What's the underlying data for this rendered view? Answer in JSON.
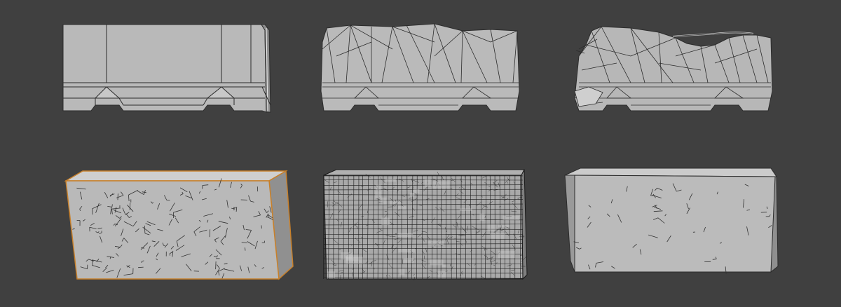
{
  "viewport": {
    "background": "#404040"
  },
  "colors": {
    "mesh_face": "#b8b8b8",
    "mesh_face_light": "#c4c4c4",
    "mesh_face_dark": "#9a9a9a",
    "mesh_side": "#8c8c8c",
    "wire": "#2c2c2c",
    "selection_outline": "#c8802a",
    "dense_wire": "#1a1a1a"
  },
  "objects": [
    {
      "id": "barrier-clean",
      "kind": "jersey-barrier",
      "row": 1,
      "col": 1,
      "selected": false,
      "style": "low-poly"
    },
    {
      "id": "barrier-rough",
      "kind": "jersey-barrier",
      "row": 1,
      "col": 2,
      "selected": false,
      "style": "deformed"
    },
    {
      "id": "barrier-broken",
      "kind": "jersey-barrier",
      "row": 1,
      "col": 3,
      "selected": false,
      "style": "damaged"
    },
    {
      "id": "block-selected",
      "kind": "concrete-block",
      "row": 2,
      "col": 1,
      "selected": true,
      "style": "scatter-edges"
    },
    {
      "id": "block-dense",
      "kind": "concrete-block",
      "row": 2,
      "col": 2,
      "selected": false,
      "style": "dense-grid"
    },
    {
      "id": "block-sparse",
      "kind": "concrete-block",
      "row": 2,
      "col": 3,
      "selected": false,
      "style": "scatter-edges"
    }
  ]
}
